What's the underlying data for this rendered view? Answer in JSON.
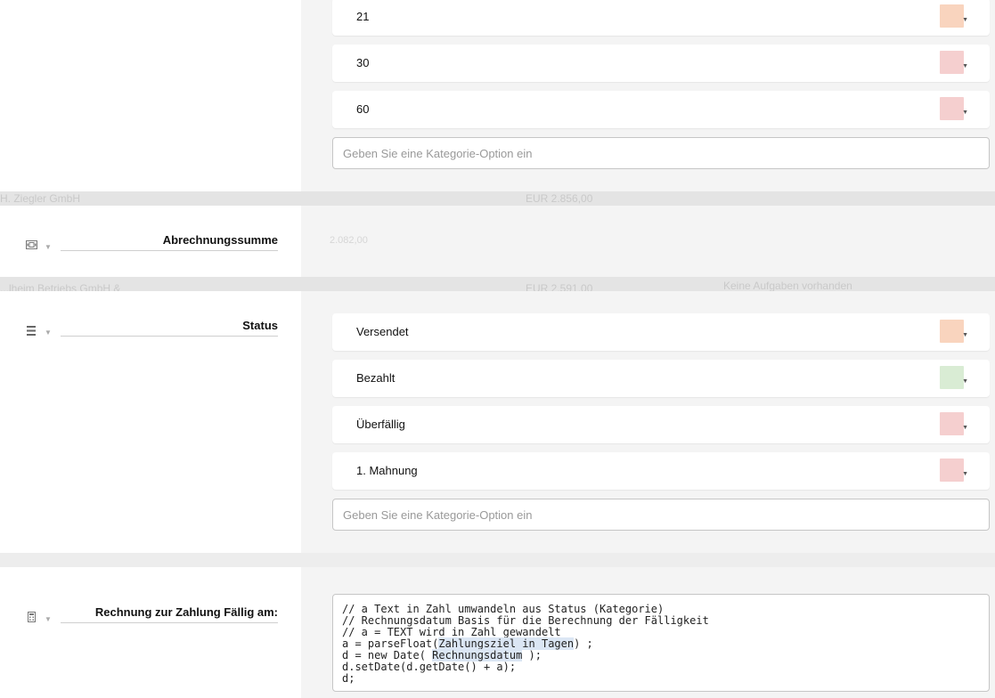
{
  "top_options": [
    {
      "label": "21",
      "color": "#f9d4be"
    },
    {
      "label": "30",
      "color": "#f5cfcf"
    },
    {
      "label": "60",
      "color": "#f5cfcf"
    }
  ],
  "top_input_placeholder": "Geben Sie eine Kategorie-Option ein",
  "ghost_row_1": {
    "company": "H. Ziegler GmbH",
    "amount": "EUR 2.856,00"
  },
  "field_sum": {
    "label": "Abrechnungssumme",
    "value": "2.082,00",
    "icon": "money-icon"
  },
  "ghost_row_2": {
    "company": "...lheim Betriebs GmbH &",
    "amount": "EUR 2.591,00",
    "note": "Keine Aufgaben vorhanden"
  },
  "field_status": {
    "label": "Status",
    "icon": "list-icon",
    "options": [
      {
        "label": "Versendet",
        "color": "#f9d4be"
      },
      {
        "label": "Bezahlt",
        "color": "#d9ecd4"
      },
      {
        "label": "Überfällig",
        "color": "#f5cfcf"
      },
      {
        "label": "1. Mahnung",
        "color": "#f5cfcf"
      }
    ],
    "input_placeholder": "Geben Sie eine Kategorie-Option ein"
  },
  "field_due": {
    "label": "Rechnung zur Zahlung Fällig am:",
    "icon": "calculator-icon",
    "code": {
      "line1": "// a Text in Zahl umwandeln aus Status (Kategorie)",
      "line2": "// Rechnungsdatum Basis für die Berechnung der Fälligkeit",
      "line3": "// a = TEXT wird in Zahl gewandelt",
      "line4_pre": "a = parseFloat(",
      "line4_ref": "Zahlungsziel in Tagen",
      "line4_post": ") ;",
      "line5_pre": "d = new Date( ",
      "line5_ref": "Rechnungsdatum",
      "line5_post": " );",
      "line6": "d.setDate(d.getDate() + a);",
      "line7": "d;"
    }
  }
}
